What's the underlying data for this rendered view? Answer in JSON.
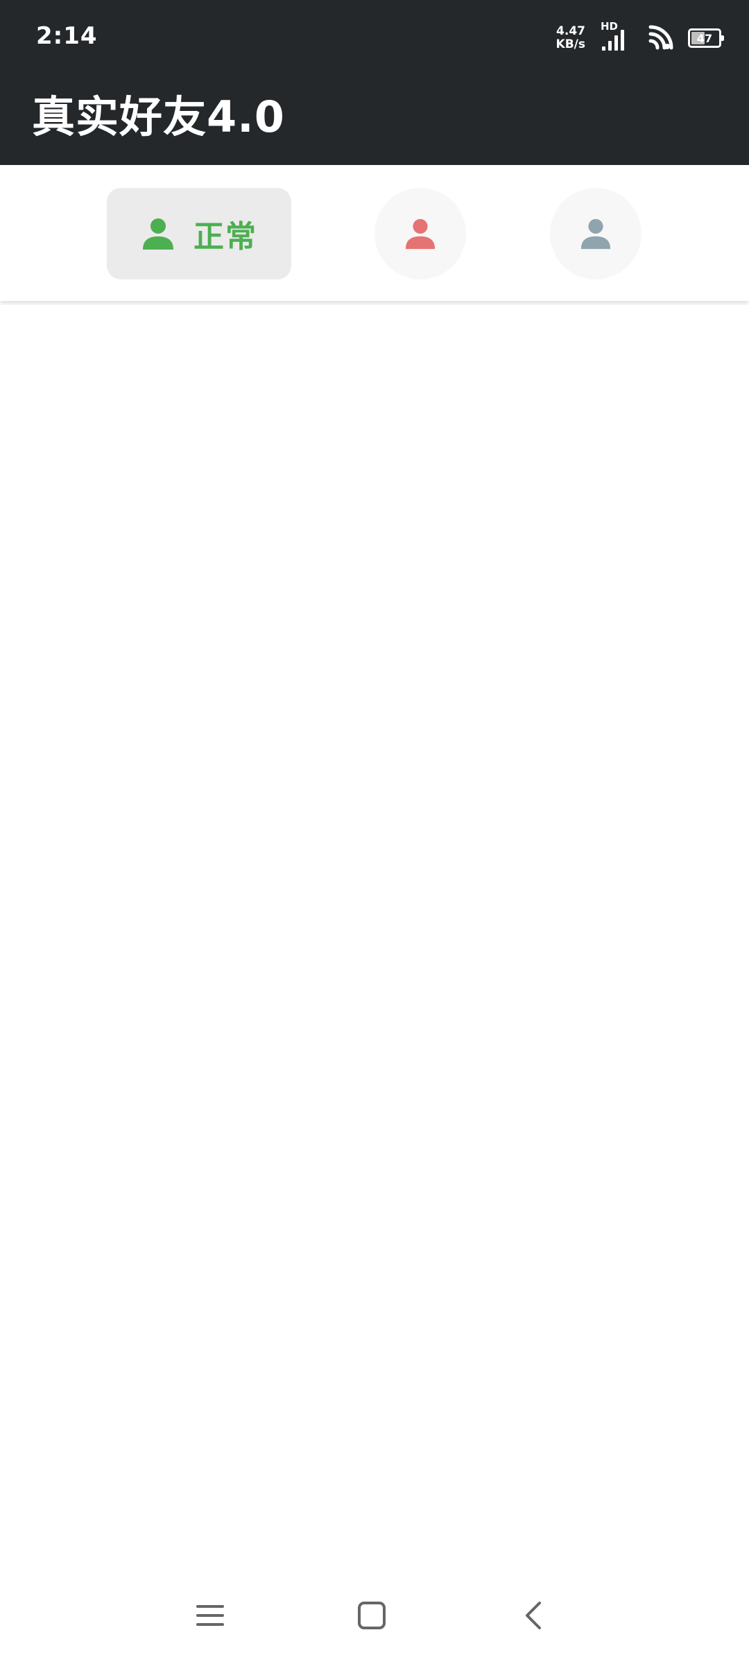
{
  "status_bar": {
    "time": "2:14",
    "net_speed_value": "4.47",
    "net_speed_unit": "KB/s",
    "signal_label": "HD",
    "battery_level": "47",
    "icons": [
      "signal-icon",
      "wifi-icon",
      "battery-icon"
    ]
  },
  "app_bar": {
    "title": "真实好友4.0"
  },
  "tabs": [
    {
      "label": "正常",
      "icon": "person-icon",
      "color": "#4caf50",
      "selected": true
    },
    {
      "label": "",
      "icon": "person-icon",
      "color": "#e57373",
      "selected": false
    },
    {
      "label": "",
      "icon": "person-icon",
      "color": "#90a4ae",
      "selected": false
    }
  ],
  "nav_bar": {
    "buttons": [
      "menu-icon",
      "home-icon",
      "back-icon"
    ]
  },
  "colors": {
    "header_bg": "#24282b",
    "accent_green": "#4caf50",
    "accent_red": "#e57373",
    "accent_gray": "#90a4ae"
  }
}
